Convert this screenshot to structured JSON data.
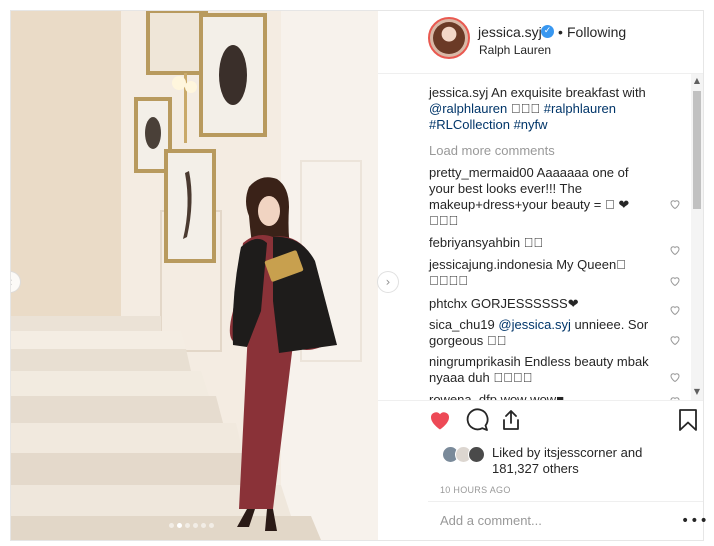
{
  "post": {
    "username": "jessica.syj",
    "verified_icon": "verified-badge-icon",
    "separator": "•",
    "follow_status": "Following",
    "location": "Ralph Lauren",
    "caption": {
      "user": "jessica.syj",
      "text": " An exquisite breakfast with ",
      "mention": "@ralphlauren",
      "emoji": " 􏰀􏰀􏰀 ",
      "tags": [
        "#ralphlauren",
        "#RLCollection",
        "#nyfw"
      ]
    },
    "load_more": "Load more comments",
    "comments": [
      {
        "user": "pretty_mermaid00",
        "text": " Aaaaaaa one of your best looks ever!!! The makeup+dress+your beauty = 􏰀 ❤ 􏰀􏰀􏰀"
      },
      {
        "user": "febriyansyahbin",
        "text": " 􏰀􏰀"
      },
      {
        "user": "jessicajung.indonesia",
        "text": " My Queen􏰀 􏰀􏰀􏰀􏰀"
      },
      {
        "user": "phtchx",
        "text": " GORJESSSSSS❤"
      },
      {
        "user": "sica_chu19",
        "mention": " @jessica.syj",
        "text": " unnieee. Sor gorgeous 􏰀􏰀"
      },
      {
        "user": "ningrumprikasih",
        "text": " Endless beauty mbak nyaaa duh 􏰀􏰀􏰀􏰀"
      },
      {
        "user": "rowena_dfp",
        "text": " wow wow■"
      }
    ],
    "likes": {
      "prefix": "Liked by ",
      "user": "itsjesscorner",
      "middle": " and ",
      "count": "181,327 others"
    },
    "timestamp": "10 HOURS AGO",
    "comment_placeholder": "Add a comment...",
    "more_options": "•••",
    "carousel": {
      "total": 6,
      "active": 1
    },
    "icons": {
      "like": "heart-filled-icon",
      "comment": "comment-bubble-icon",
      "share": "share-icon",
      "save": "bookmark-icon"
    },
    "colors": {
      "like_red": "#ed4956",
      "link_blue": "#003569",
      "verified_blue": "#3897f0",
      "meta_gray": "#999999"
    }
  }
}
